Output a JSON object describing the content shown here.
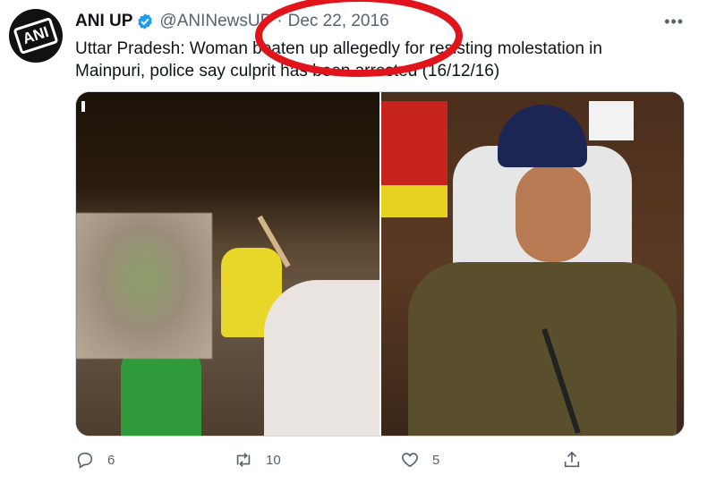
{
  "tweet": {
    "avatar_text": "ANI",
    "display_name": "ANI UP",
    "handle": "@ANINewsUP",
    "separator": "·",
    "date": "Dec 22, 2016",
    "more_label": "•••",
    "text": "Uttar Pradesh: Woman beaten up allegedly for resisting molestation in Mainpuri, police say culprit has been arrested (16/12/16)"
  },
  "actions": {
    "reply_count": "6",
    "retweet_count": "10",
    "like_count": "5"
  },
  "icons": {
    "verified": "verified-badge-icon",
    "reply": "reply-icon",
    "retweet": "retweet-icon",
    "like": "heart-icon",
    "share": "share-icon"
  },
  "colors": {
    "verified": "#1d9bf0",
    "annotation": "#e0141b",
    "secondary_text": "#536471"
  }
}
